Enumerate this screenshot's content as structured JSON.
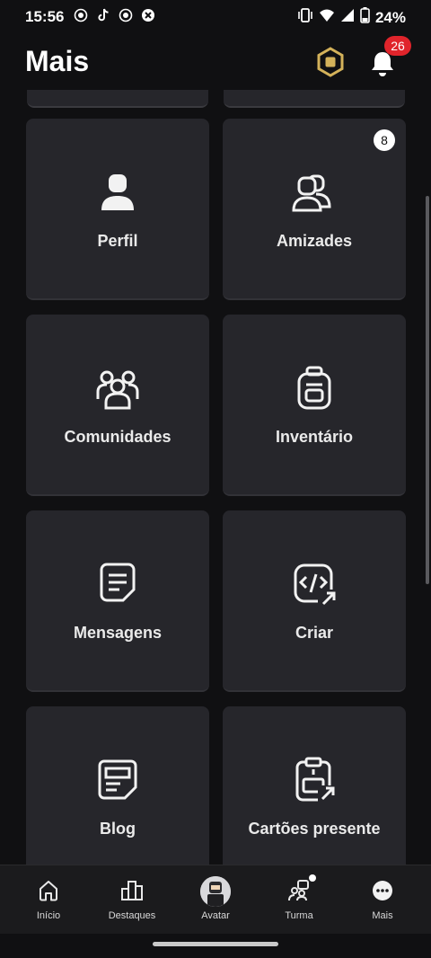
{
  "status_bar": {
    "time": "15:56",
    "battery": "24%"
  },
  "header": {
    "title": "Mais",
    "notification_count": "26"
  },
  "tiles": [
    {
      "label": "Perfil",
      "icon": "person-icon"
    },
    {
      "label": "Amizades",
      "icon": "friends-icon",
      "badge": "8"
    },
    {
      "label": "Comunidades",
      "icon": "communities-icon"
    },
    {
      "label": "Inventário",
      "icon": "backpack-icon"
    },
    {
      "label": "Mensagens",
      "icon": "message-icon"
    },
    {
      "label": "Criar",
      "icon": "code-icon"
    },
    {
      "label": "Blog",
      "icon": "blog-icon"
    },
    {
      "label": "Cartões presente",
      "icon": "gift-card-icon"
    }
  ],
  "nav": [
    {
      "label": "Início",
      "icon": "home-icon"
    },
    {
      "label": "Destaques",
      "icon": "chart-icon"
    },
    {
      "label": "Avatar",
      "icon": "avatar-icon"
    },
    {
      "label": "Turma",
      "icon": "party-icon"
    },
    {
      "label": "Mais",
      "icon": "more-icon"
    }
  ],
  "colors": {
    "background": "#101012",
    "tile": "#26262b",
    "badge_red": "#e0242b",
    "robux_gold": "#d4b25a"
  }
}
